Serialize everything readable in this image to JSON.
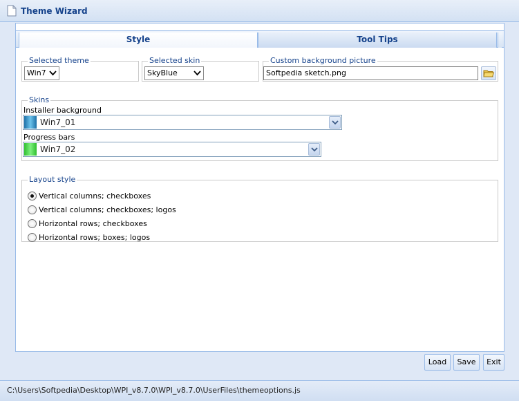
{
  "window": {
    "title": "Theme Wizard",
    "icon": "document-icon"
  },
  "tabs": [
    {
      "label": "Style",
      "active": true
    },
    {
      "label": "Tool Tips",
      "active": false
    }
  ],
  "selected_theme": {
    "legend": "Selected theme",
    "value": "Win7"
  },
  "selected_skin": {
    "legend": "Selected skin",
    "value": "SkyBlue"
  },
  "custom_background": {
    "legend": "Custom background picture",
    "value": "Softpedia sketch.png",
    "button_icon": "folder-icon"
  },
  "skins": {
    "legend": "Skins",
    "installer_background": {
      "label": "Installer background",
      "value": "Win7_01",
      "swatch_color": "#2f8fc6"
    },
    "progress_bars": {
      "label": "Progress bars",
      "value": "Win7_02",
      "swatch_color": "#33cc33"
    }
  },
  "layout_style": {
    "legend": "Layout style",
    "options": [
      {
        "label": "Vertical columns; checkboxes",
        "selected": true
      },
      {
        "label": "Vertical columns; checkboxes; logos",
        "selected": false
      },
      {
        "label": "Horizontal rows; checkboxes",
        "selected": false
      },
      {
        "label": "Horizontal rows; boxes; logos",
        "selected": false
      }
    ]
  },
  "buttons": {
    "load": "Load",
    "save": "Save",
    "exit": "Exit"
  },
  "status": {
    "path": "C:\\Users\\Softpedia\\Desktop\\WPI_v8.7.0\\WPI_v8.7.0\\UserFiles\\themeoptions.js"
  },
  "colors": {
    "accent": "#15428b",
    "border": "#99bbe8",
    "background": "#dfe8f6"
  }
}
